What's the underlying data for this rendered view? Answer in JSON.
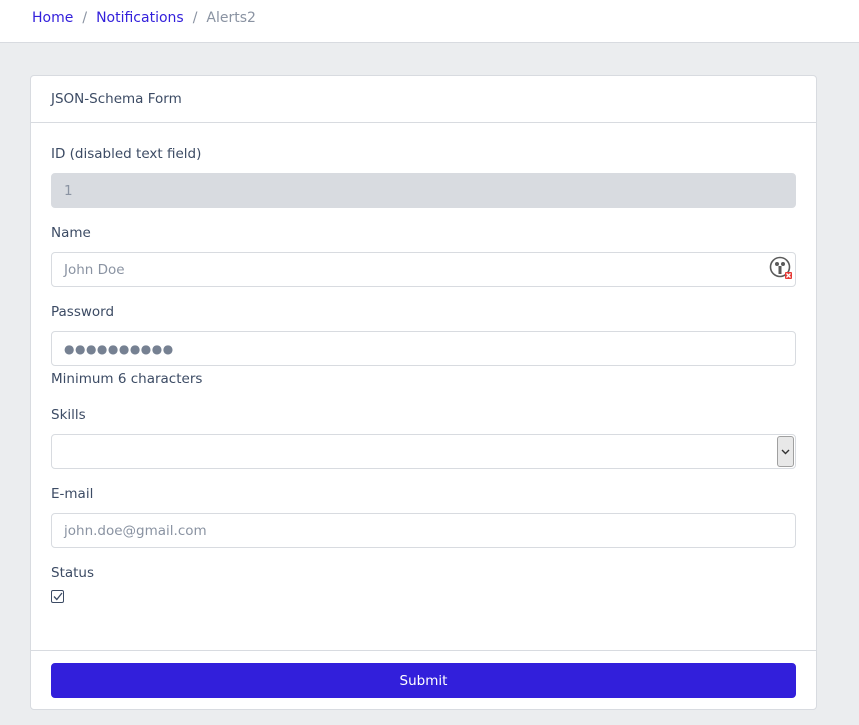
{
  "breadcrumb": {
    "items": [
      "Home",
      "Notifications"
    ],
    "separator": "/",
    "active": "Alerts2"
  },
  "card": {
    "title": "JSON-Schema Form"
  },
  "form": {
    "id": {
      "label": "ID (disabled text field)",
      "value": "1"
    },
    "name": {
      "label": "Name",
      "placeholder": "John Doe"
    },
    "password": {
      "label": "Password",
      "value": "●●●●●●●●●●",
      "help": "Minimum 6 characters"
    },
    "skills": {
      "label": "Skills",
      "value": ""
    },
    "email": {
      "label": "E-mail",
      "placeholder": "john.doe@gmail.com"
    },
    "status": {
      "label": "Status",
      "checked": true
    }
  },
  "footer": {
    "submit_label": "Submit"
  },
  "colors": {
    "primary": "#321fdb",
    "background": "#ebedef",
    "border": "#d8dbe0",
    "text": "#3c4b64"
  },
  "icons": {
    "autofill": "password-manager-icon",
    "select": "chevron-down-icon",
    "checkbox": "check-icon"
  }
}
